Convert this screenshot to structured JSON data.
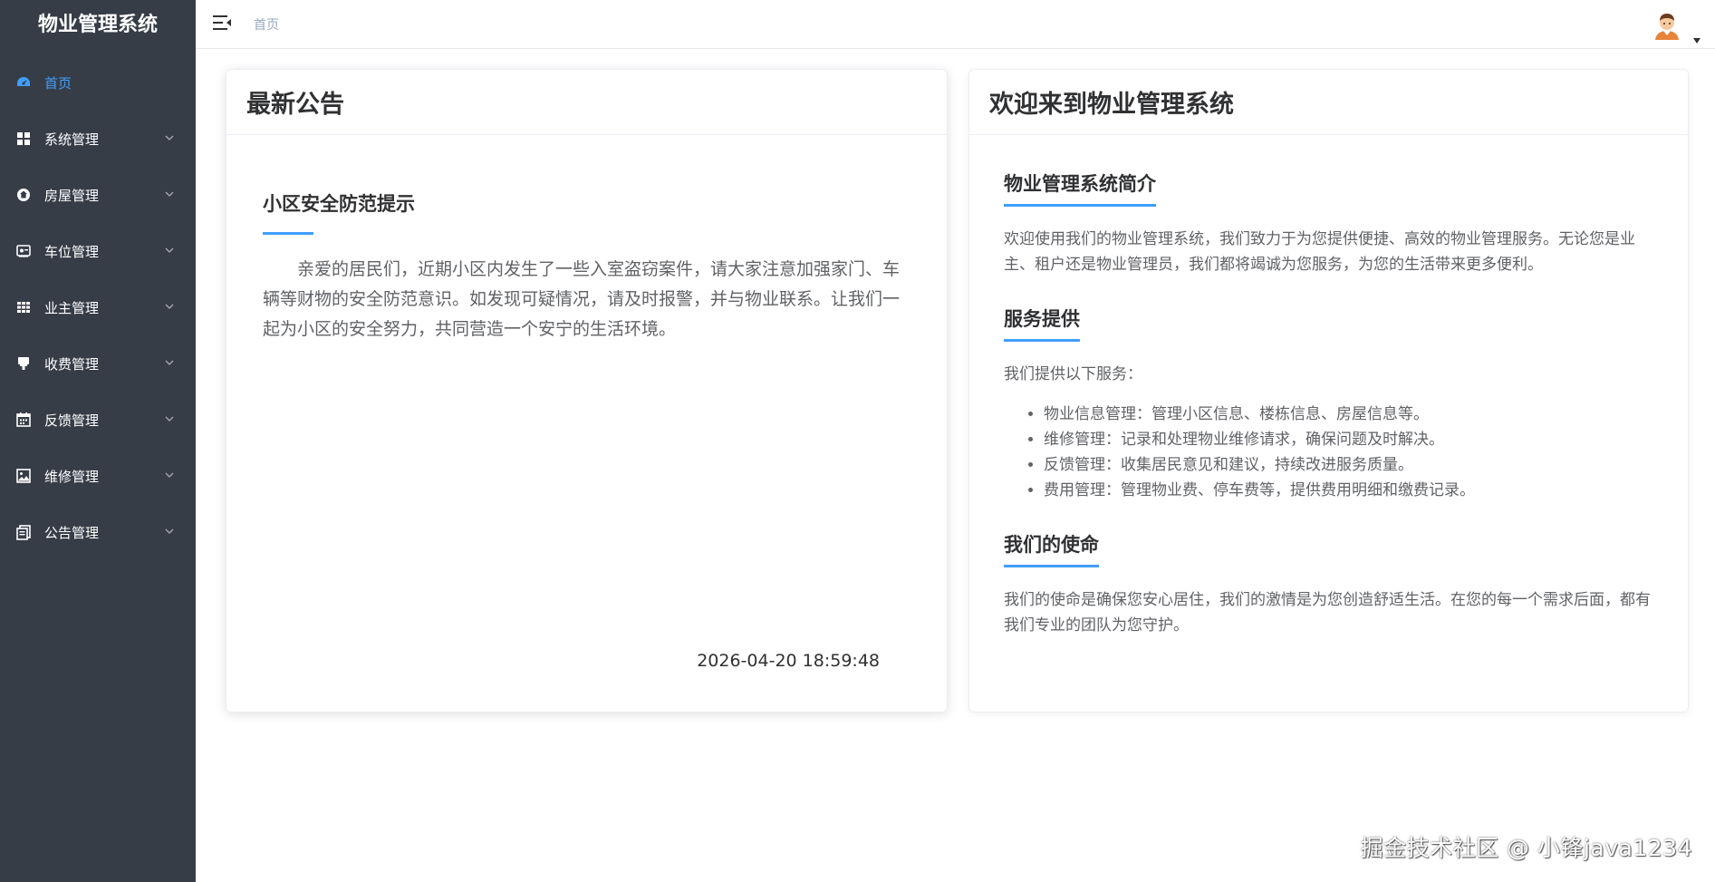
{
  "sidebar": {
    "app_title": "物业管理系统",
    "items": [
      {
        "label": "首页",
        "icon": "dashboard-icon",
        "active": true
      },
      {
        "label": "系统管理",
        "icon": "grid-icon"
      },
      {
        "label": "房屋管理",
        "icon": "house-icon"
      },
      {
        "label": "车位管理",
        "icon": "parking-icon"
      },
      {
        "label": "业主管理",
        "icon": "table-icon"
      },
      {
        "label": "收费管理",
        "icon": "fee-icon"
      },
      {
        "label": "反馈管理",
        "icon": "calendar-icon"
      },
      {
        "label": "维修管理",
        "icon": "picture-icon"
      },
      {
        "label": "公告管理",
        "icon": "document-icon"
      }
    ]
  },
  "header": {
    "breadcrumb": "首页"
  },
  "notice_card": {
    "header": "最新公告",
    "title": "小区安全防范提示",
    "content": "亲爱的居民们，近期小区内发生了一些入室盗窃案件，请大家注意加强家门、车辆等财物的安全防范意识。如发现可疑情况，请及时报警，并与物业联系。让我们一起为小区的安全努力，共同营造一个安宁的生活环境。",
    "time": "2026-04-20 18:59:48"
  },
  "welcome_card": {
    "header": "欢迎来到物业管理系统",
    "sections": {
      "intro_title": "物业管理系统简介",
      "intro_text": "欢迎使用我们的物业管理系统，我们致力于为您提供便捷、高效的物业管理服务。无论您是业主、租户还是物业管理员，我们都将竭诚为您服务，为您的生活带来更多便利。",
      "service_title": "服务提供",
      "service_text": "我们提供以下服务：",
      "services": [
        "物业信息管理：管理小区信息、楼栋信息、房屋信息等。",
        "维修管理：记录和处理物业维修请求，确保问题及时解决。",
        "反馈管理：收集居民意见和建议，持续改进服务质量。",
        "费用管理：管理物业费、停车费等，提供费用明细和缴费记录。"
      ],
      "mission_title": "我们的使命",
      "mission_text": "我们的使命是确保您安心居住，我们的激情是为您创造舒适生活。在您的每一个需求后面，都有我们专业的团队为您守护。"
    }
  },
  "watermark": "掘金技术社区 @ 小锋java1234",
  "colors": {
    "sidebar_bg": "#373d47",
    "accent": "#409eff",
    "text": "#606266"
  }
}
